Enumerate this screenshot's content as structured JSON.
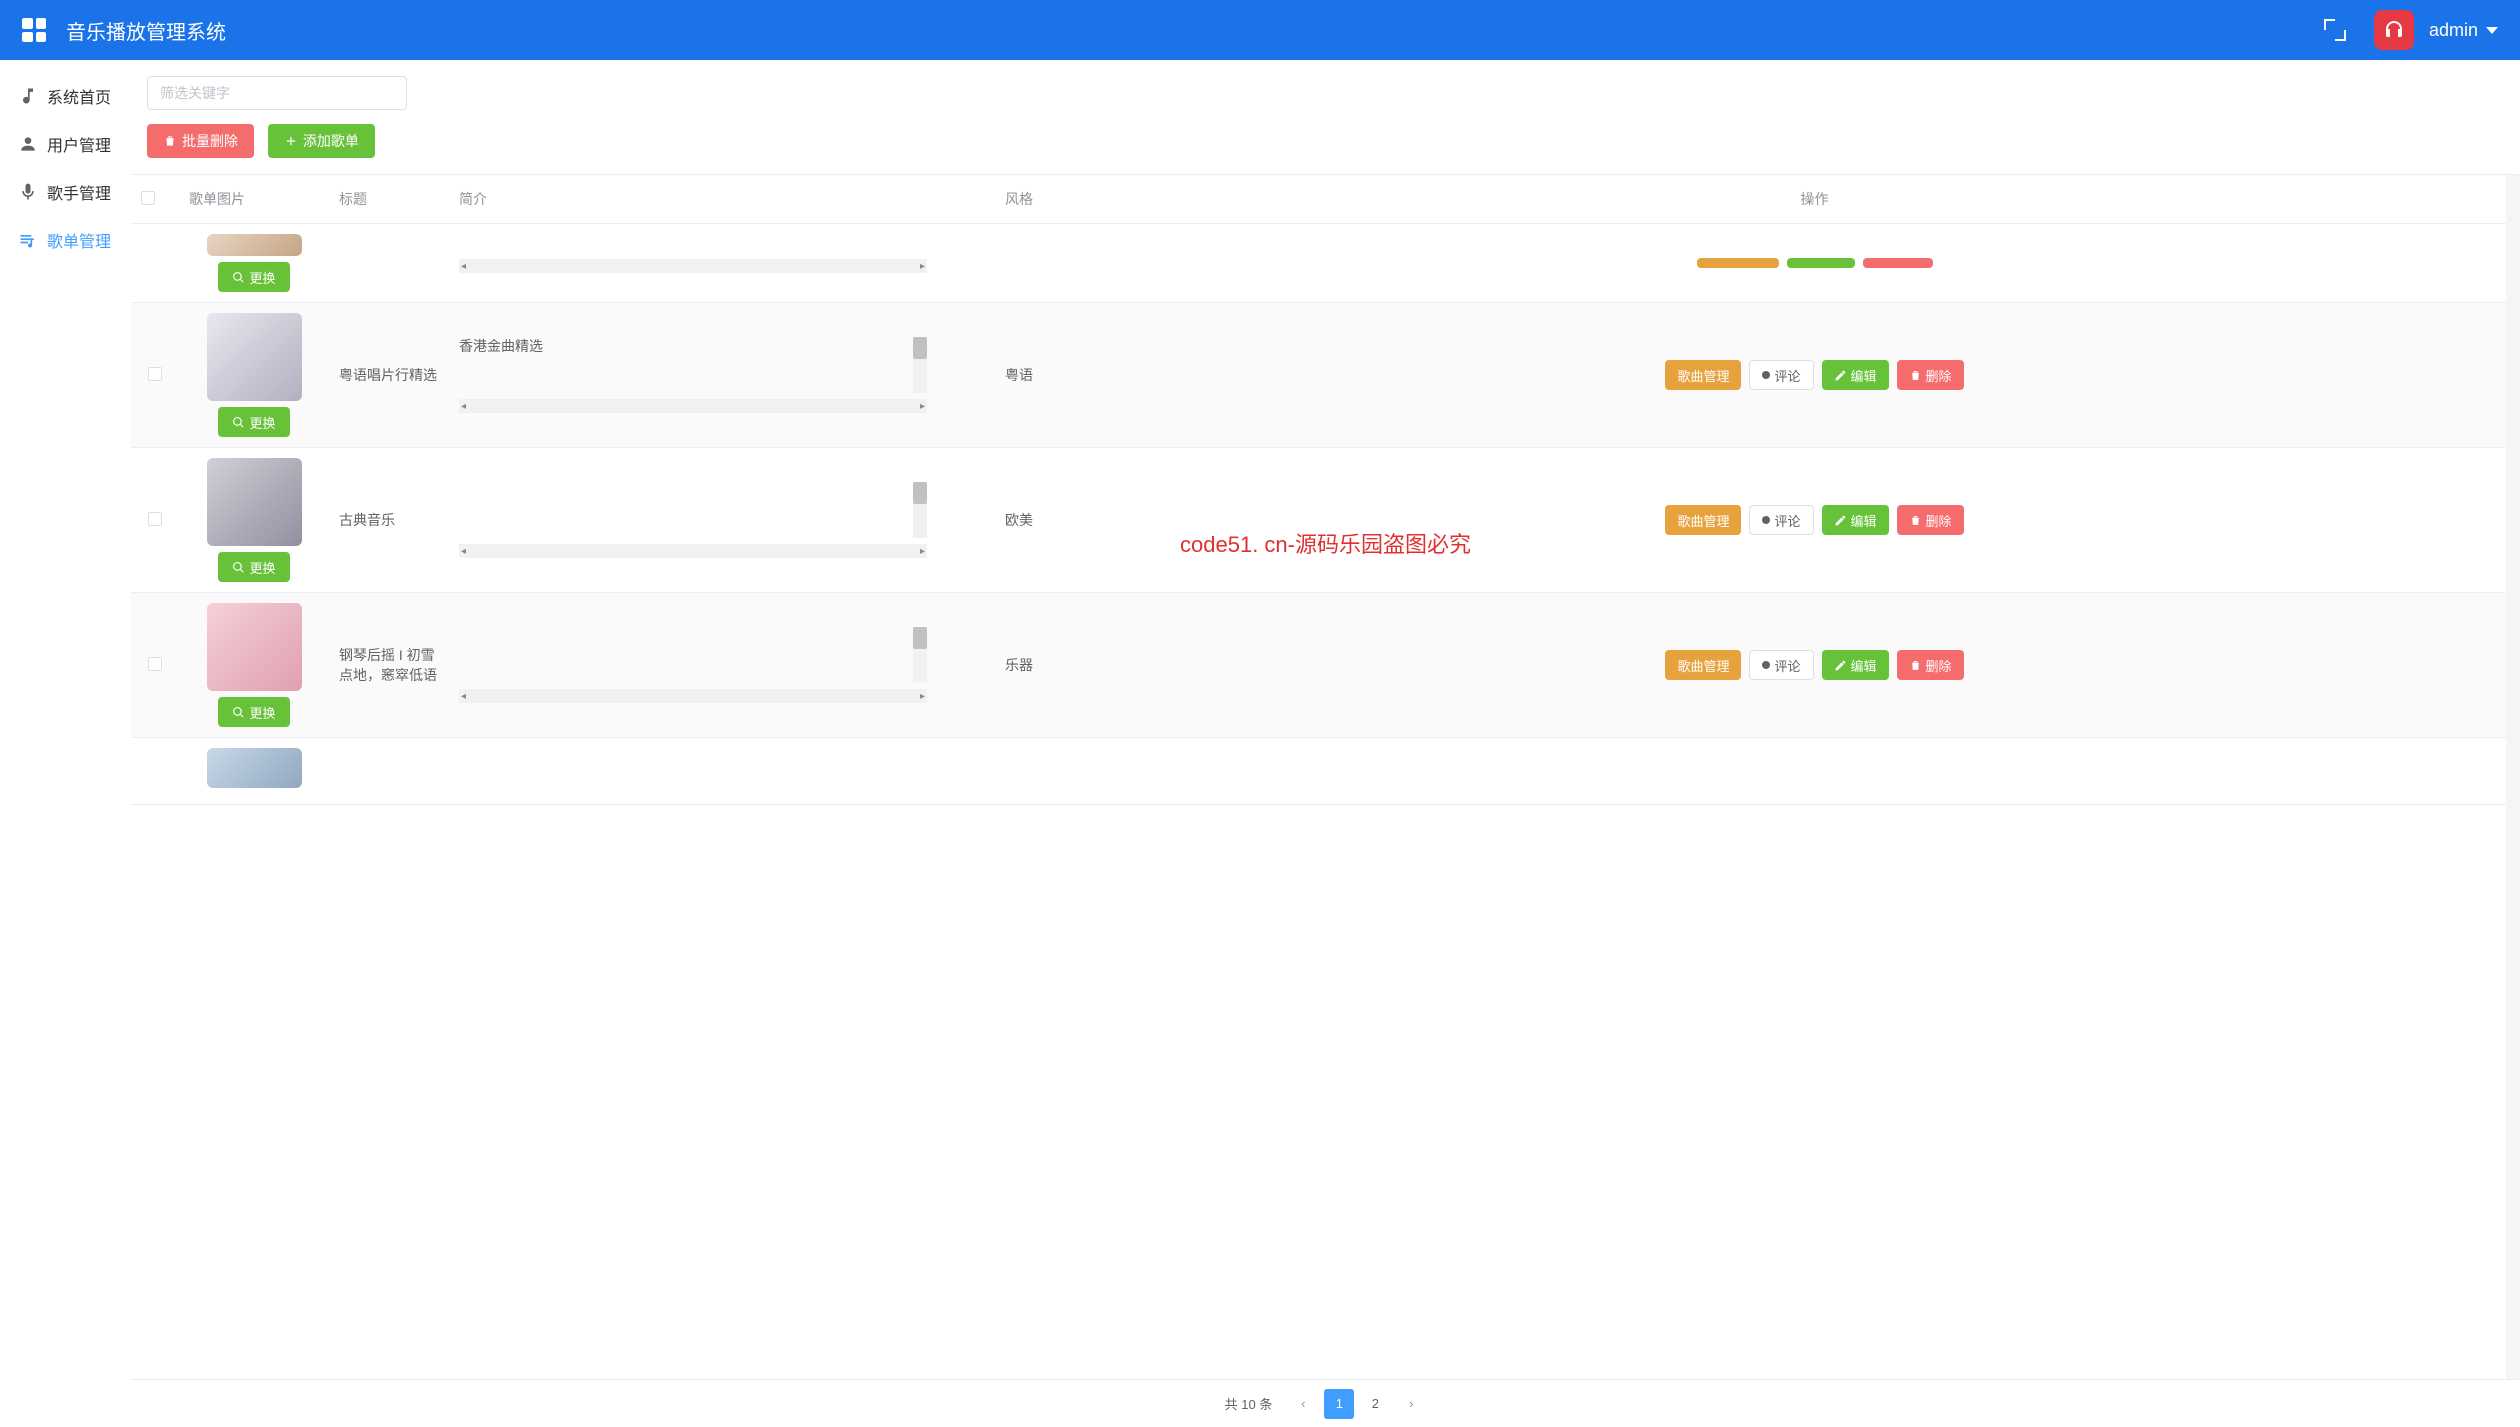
{
  "header": {
    "app_title": "音乐播放管理系统",
    "username": "admin"
  },
  "sidebar": {
    "items": [
      {
        "label": "系统首页",
        "icon": "music-note-icon"
      },
      {
        "label": "用户管理",
        "icon": "user-icon"
      },
      {
        "label": "歌手管理",
        "icon": "mic-icon"
      },
      {
        "label": "歌单管理",
        "icon": "playlist-icon",
        "active": true
      }
    ]
  },
  "toolbar": {
    "search_placeholder": "筛选关键字",
    "batch_delete": "批量删除",
    "add_playlist": "添加歌单"
  },
  "table": {
    "columns": {
      "img": "歌单图片",
      "title": "标题",
      "intro": "简介",
      "style": "风格",
      "ops": "操作"
    },
    "change_btn": "更换",
    "op_labels": {
      "song_manage": "歌曲管理",
      "comment": "评论",
      "edit": "编辑",
      "delete": "删除"
    },
    "rows": [
      {
        "title": "",
        "intro": "",
        "style": "",
        "partial_top": true
      },
      {
        "title": "粤语唱片行精选",
        "intro": "香港金曲精选",
        "style": "粤语"
      },
      {
        "title": "古典音乐",
        "intro": "",
        "style": "欧美"
      },
      {
        "title": "钢琴后摇 I 初雪点地，窸窣低语",
        "intro": "",
        "style": "乐器"
      },
      {
        "title": "",
        "intro": "",
        "style": "",
        "partial_bottom": true
      }
    ]
  },
  "watermark_text": "code51. cn-源码乐园盗图必究",
  "pager": {
    "total_label": "共 10 条",
    "pages": [
      "1",
      "2"
    ],
    "current": "1"
  },
  "colors": {
    "primary": "#409eff",
    "success": "#67c23a",
    "warning": "#e6a23c",
    "danger": "#f56c6c",
    "header": "#1a73e8"
  }
}
